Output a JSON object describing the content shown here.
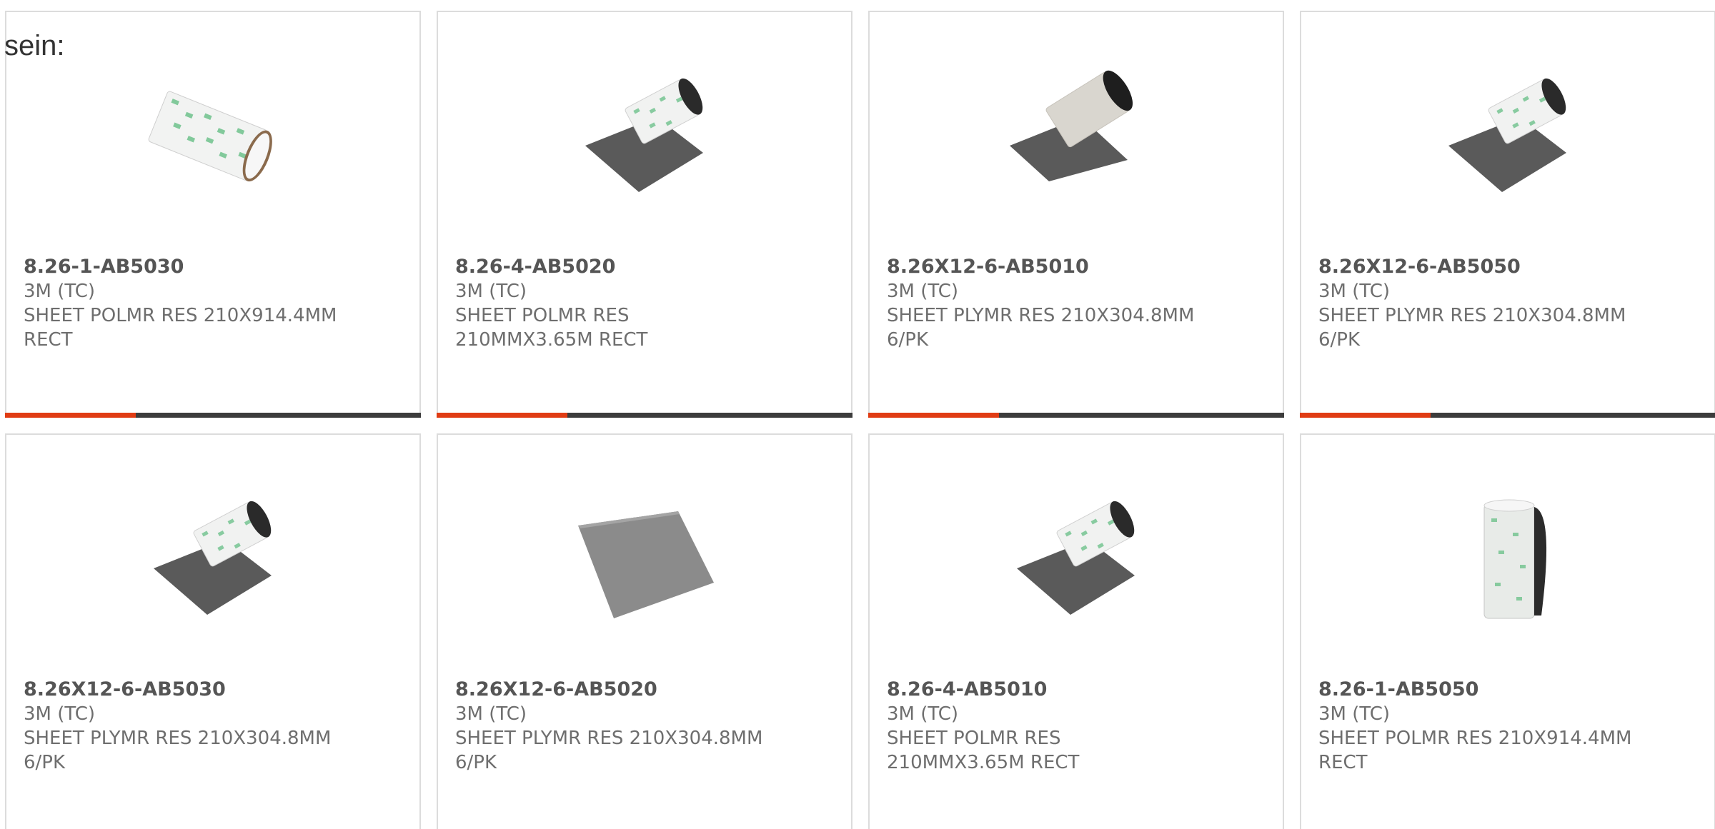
{
  "intro": {
    "text": "sein:"
  },
  "colors": {
    "accent": "#e03c14",
    "bar_track": "#3c3c3c",
    "card_border": "#dcdcdc",
    "text": "#6e6e6e"
  },
  "products": [
    {
      "part_number": "8.26-1-AB5030",
      "manufacturer": "3M (TC)",
      "description": "SHEET POLMR RES 210X914.4MM\nRECT",
      "image": "tube-roll-white",
      "bar_fill": 0.315
    },
    {
      "part_number": "8.26-4-AB5020",
      "manufacturer": "3M (TC)",
      "description": "SHEET POLMR RES\n210MMX3.65M RECT",
      "image": "roll-gray-sheet",
      "bar_fill": 0.315
    },
    {
      "part_number": "8.26X12-6-AB5010",
      "manufacturer": "3M (TC)",
      "description": "SHEET PLYMR RES 210X304.8MM\n6/PK",
      "image": "roll-gray-sheet-plain",
      "bar_fill": 0.315
    },
    {
      "part_number": "8.26X12-6-AB5050",
      "manufacturer": "3M (TC)",
      "description": "SHEET PLYMR RES 210X304.8MM\n6/PK",
      "image": "roll-gray-sheet",
      "bar_fill": 0.315
    },
    {
      "part_number": "8.26X12-6-AB5030",
      "manufacturer": "3M (TC)",
      "description": "SHEET PLYMR RES 210X304.8MM\n6/PK",
      "image": "roll-gray-sheet",
      "bar_fill": 0.315
    },
    {
      "part_number": "8.26X12-6-AB5020",
      "manufacturer": "3M (TC)",
      "description": "SHEET PLYMR RES 210X304.8MM\n6/PK",
      "image": "flat-gray-sheet",
      "bar_fill": 0.315
    },
    {
      "part_number": "8.26-4-AB5010",
      "manufacturer": "3M (TC)",
      "description": "SHEET POLMR RES\n210MMX3.65M RECT",
      "image": "roll-gray-sheet",
      "bar_fill": 0.315
    },
    {
      "part_number": "8.26-1-AB5050",
      "manufacturer": "3M (TC)",
      "description": "SHEET POLMR RES 210X914.4MM\nRECT",
      "image": "upright-roll",
      "bar_fill": 0.315
    }
  ]
}
